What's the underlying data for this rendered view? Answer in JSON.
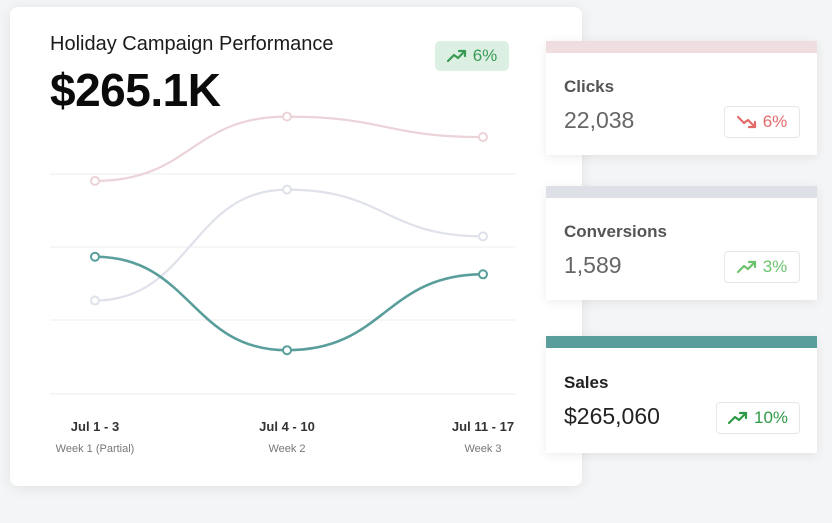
{
  "header": {
    "title": "Holiday Campaign Performance",
    "value": "$265.1K",
    "trend": "6%",
    "trend_dir": "up"
  },
  "chart_data": {
    "type": "line",
    "categories": [
      "Jul 1 - 3",
      "Jul 4 - 10",
      "Jul 11 - 17"
    ],
    "sublabels": [
      "Week 1 (Partial)",
      "Week 2",
      "Week 3"
    ],
    "series": [
      {
        "name": "Clicks",
        "color": "#ecd3d8",
        "values": [
          0.73,
          0.95,
          0.88
        ]
      },
      {
        "name": "Conversions",
        "color": "#dfe2ea",
        "values": [
          0.32,
          0.7,
          0.54
        ]
      },
      {
        "name": "Sales",
        "color": "#5a9e9b",
        "values": [
          0.47,
          0.15,
          0.41
        ]
      }
    ],
    "ylim": [
      0,
      1
    ],
    "grid": true
  },
  "kpis": [
    {
      "label": "Clicks",
      "value": "22,038",
      "trend": "6%",
      "dir": "down",
      "bar_color": "#f0dde0",
      "trend_color": "#e46a6a"
    },
    {
      "label": "Conversions",
      "value": "1,589",
      "trend": "3%",
      "dir": "up",
      "bar_color": "#dde0e6",
      "trend_color": "#6cc36e"
    },
    {
      "label": "Sales",
      "value": "$265,060",
      "trend": "10%",
      "dir": "up",
      "bar_color": "#5a9e9b",
      "trend_color": "#2f9a45"
    }
  ]
}
